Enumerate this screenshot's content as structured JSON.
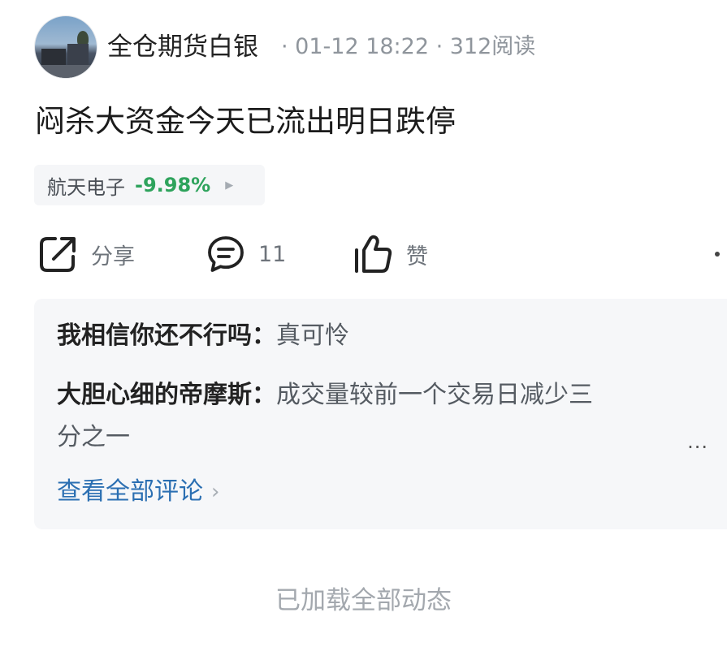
{
  "post": {
    "author": "全仓期货白银",
    "meta": "· 01-12 18:22 · 312阅读",
    "title": "闷杀大资金今天已流出明日跌停"
  },
  "stock": {
    "name": "航天电子",
    "change": "-9.98%",
    "change_color": "#2ea35c"
  },
  "actions": {
    "share_label": "分享",
    "comment_count": "11",
    "like_label": "赞",
    "icons": [
      "share-icon",
      "comment-icon",
      "thumbs-up-icon",
      "more-icon"
    ]
  },
  "comments": [
    {
      "user": "我相信你还不行吗：",
      "text": "真可怜"
    },
    {
      "user": "大胆心细的帝摩斯：",
      "text": "成交量较前一个交易日减少三",
      "text_cont": "分之一"
    }
  ],
  "comments_more": "...",
  "view_all_label": "查看全部评论",
  "footer_text": "已加载全部动态",
  "colors": {
    "link": "#2b6fb2",
    "muted": "#8f959c",
    "card_bg": "#f6f7f9"
  }
}
